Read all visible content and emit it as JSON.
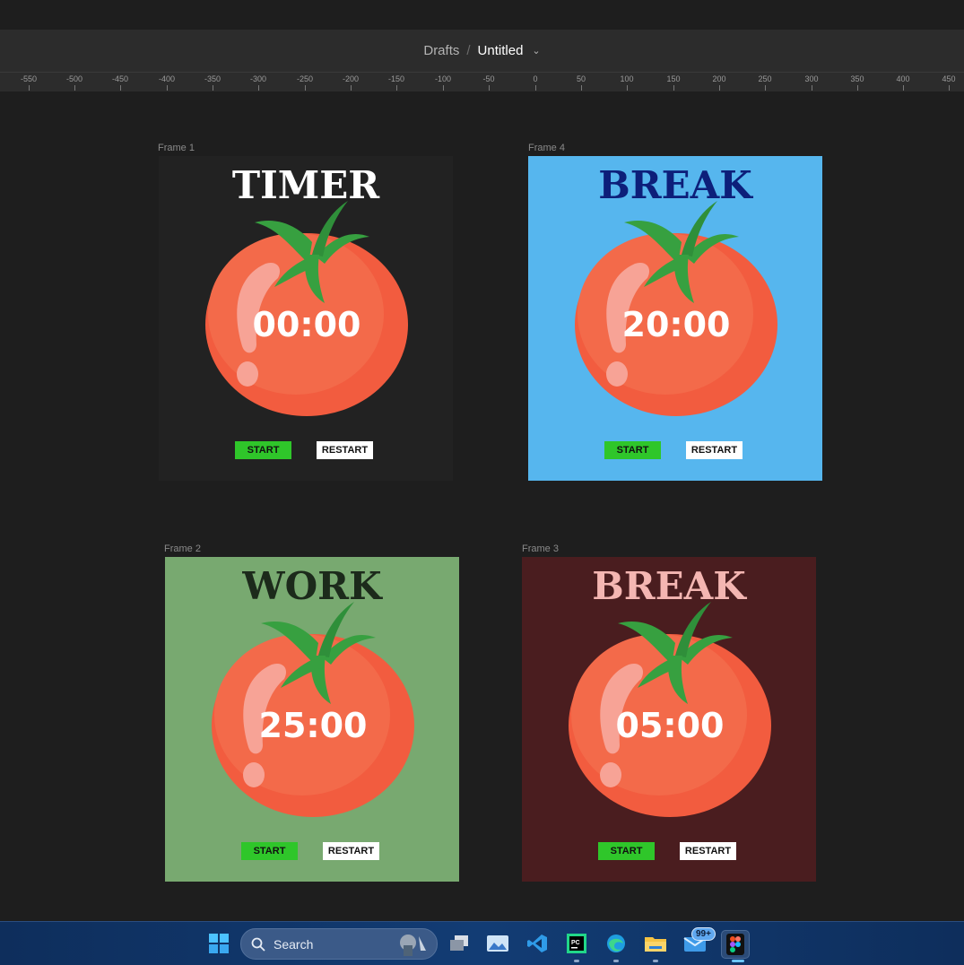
{
  "header": {
    "breadcrumb": "Drafts",
    "separator": "/",
    "file_title": "Untitled"
  },
  "ruler": {
    "ticks": [
      "-550",
      "-500",
      "-450",
      "-400",
      "-350",
      "-300",
      "-250",
      "-200",
      "-150",
      "-100",
      "-50",
      "0",
      "50",
      "100",
      "150",
      "200",
      "250",
      "300",
      "350",
      "400",
      "450"
    ]
  },
  "frames": [
    {
      "label": "Frame 1",
      "heading": "TIMER",
      "time": "00:00",
      "start": "START",
      "restart": "RESTART",
      "bg": "#222222",
      "heading_color": "#ffffff"
    },
    {
      "label": "Frame 4",
      "heading": "BREAK",
      "time": "20:00",
      "start": "START",
      "restart": "RESTART",
      "bg": "#56b6ee",
      "heading_color": "#0d1f7a"
    },
    {
      "label": "Frame 2",
      "heading": "WORK",
      "time": "25:00",
      "start": "START",
      "restart": "RESTART",
      "bg": "#78a970",
      "heading_color": "#1c2a1b"
    },
    {
      "label": "Frame 3",
      "heading": "BREAK",
      "time": "05:00",
      "start": "START",
      "restart": "RESTART",
      "bg": "#4a1d1f",
      "heading_color": "#f4b6b2"
    }
  ],
  "taskbar": {
    "search_label": "Search",
    "mail_badge": "99+"
  }
}
